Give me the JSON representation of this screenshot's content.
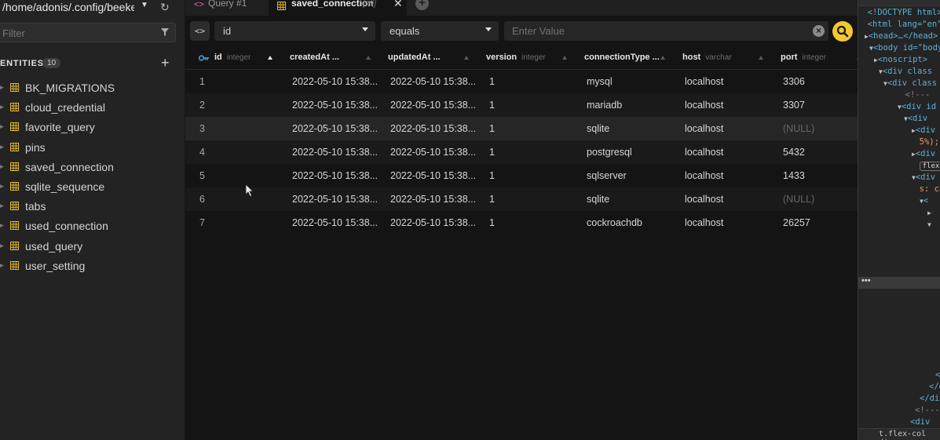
{
  "sidebar": {
    "connection_path": "/home/adonis/.config/beekeeper",
    "filter_placeholder": "Filter",
    "entities_title": "ENTITIES",
    "entities_count": "10",
    "tables": [
      "BK_MIGRATIONS",
      "cloud_credential",
      "favorite_query",
      "pins",
      "saved_connection",
      "sqlite_sequence",
      "tabs",
      "used_connection",
      "used_query",
      "user_setting"
    ]
  },
  "tabs": {
    "query_label": "Query #1",
    "saved_label": "saved_connection",
    "saved_suffix": "[all]"
  },
  "filter": {
    "column": "id",
    "operator": "equals",
    "value_placeholder": "Enter Value"
  },
  "grid": {
    "columns": [
      {
        "name": "id",
        "type": "integer"
      },
      {
        "name": "createdAt ...",
        "type": ""
      },
      {
        "name": "updatedAt ...",
        "type": ""
      },
      {
        "name": "version",
        "type": "integer"
      },
      {
        "name": "connectionType ...",
        "type": ""
      },
      {
        "name": "host",
        "type": "varchar"
      },
      {
        "name": "port",
        "type": "integer"
      }
    ],
    "rows": [
      [
        "1",
        "2022-05-10 15:38...",
        "2022-05-10 15:38...",
        "1",
        "mysql",
        "localhost",
        "3306"
      ],
      [
        "2",
        "2022-05-10 15:38...",
        "2022-05-10 15:38...",
        "1",
        "mariadb",
        "localhost",
        "3307"
      ],
      [
        "3",
        "2022-05-10 15:38...",
        "2022-05-10 15:38...",
        "1",
        "sqlite",
        "localhost",
        "(NULL)"
      ],
      [
        "4",
        "2022-05-10 15:38...",
        "2022-05-10 15:38...",
        "1",
        "postgresql",
        "localhost",
        "5432"
      ],
      [
        "5",
        "2022-05-10 15:38...",
        "2022-05-10 15:38...",
        "1",
        "sqlserver",
        "localhost",
        "1433"
      ],
      [
        "6",
        "2022-05-10 15:38...",
        "2022-05-10 15:38...",
        "1",
        "sqlite",
        "localhost",
        "(NULL)"
      ],
      [
        "7",
        "2022-05-10 15:38...",
        "2022-05-10 15:38...",
        "1",
        "cockroachdb",
        "localhost",
        "26257"
      ]
    ]
  },
  "devtools": {
    "lines": [
      "<!DOCTYPE html>",
      "<html lang=\"en\">",
      "<head>…</head>",
      "<body id=\"body\">",
      "<noscript>",
      "<div class",
      "<div class",
      "<!---",
      "<div id",
      "<div",
      "<div",
      "5%);",
      "<div",
      "flex",
      "<div",
      "s: ca",
      "<",
      "",
      ""
    ],
    "bottom_lines": [
      "</",
      "</div",
      "</div>",
      "<!---",
      "<div"
    ],
    "footer": "t.flex-col  div"
  },
  "colors": {
    "accent": "#f2c830",
    "table_icon": "#e7b92a",
    "query_icon": "#d66fb0",
    "key_icon": "#4a9fe0"
  }
}
